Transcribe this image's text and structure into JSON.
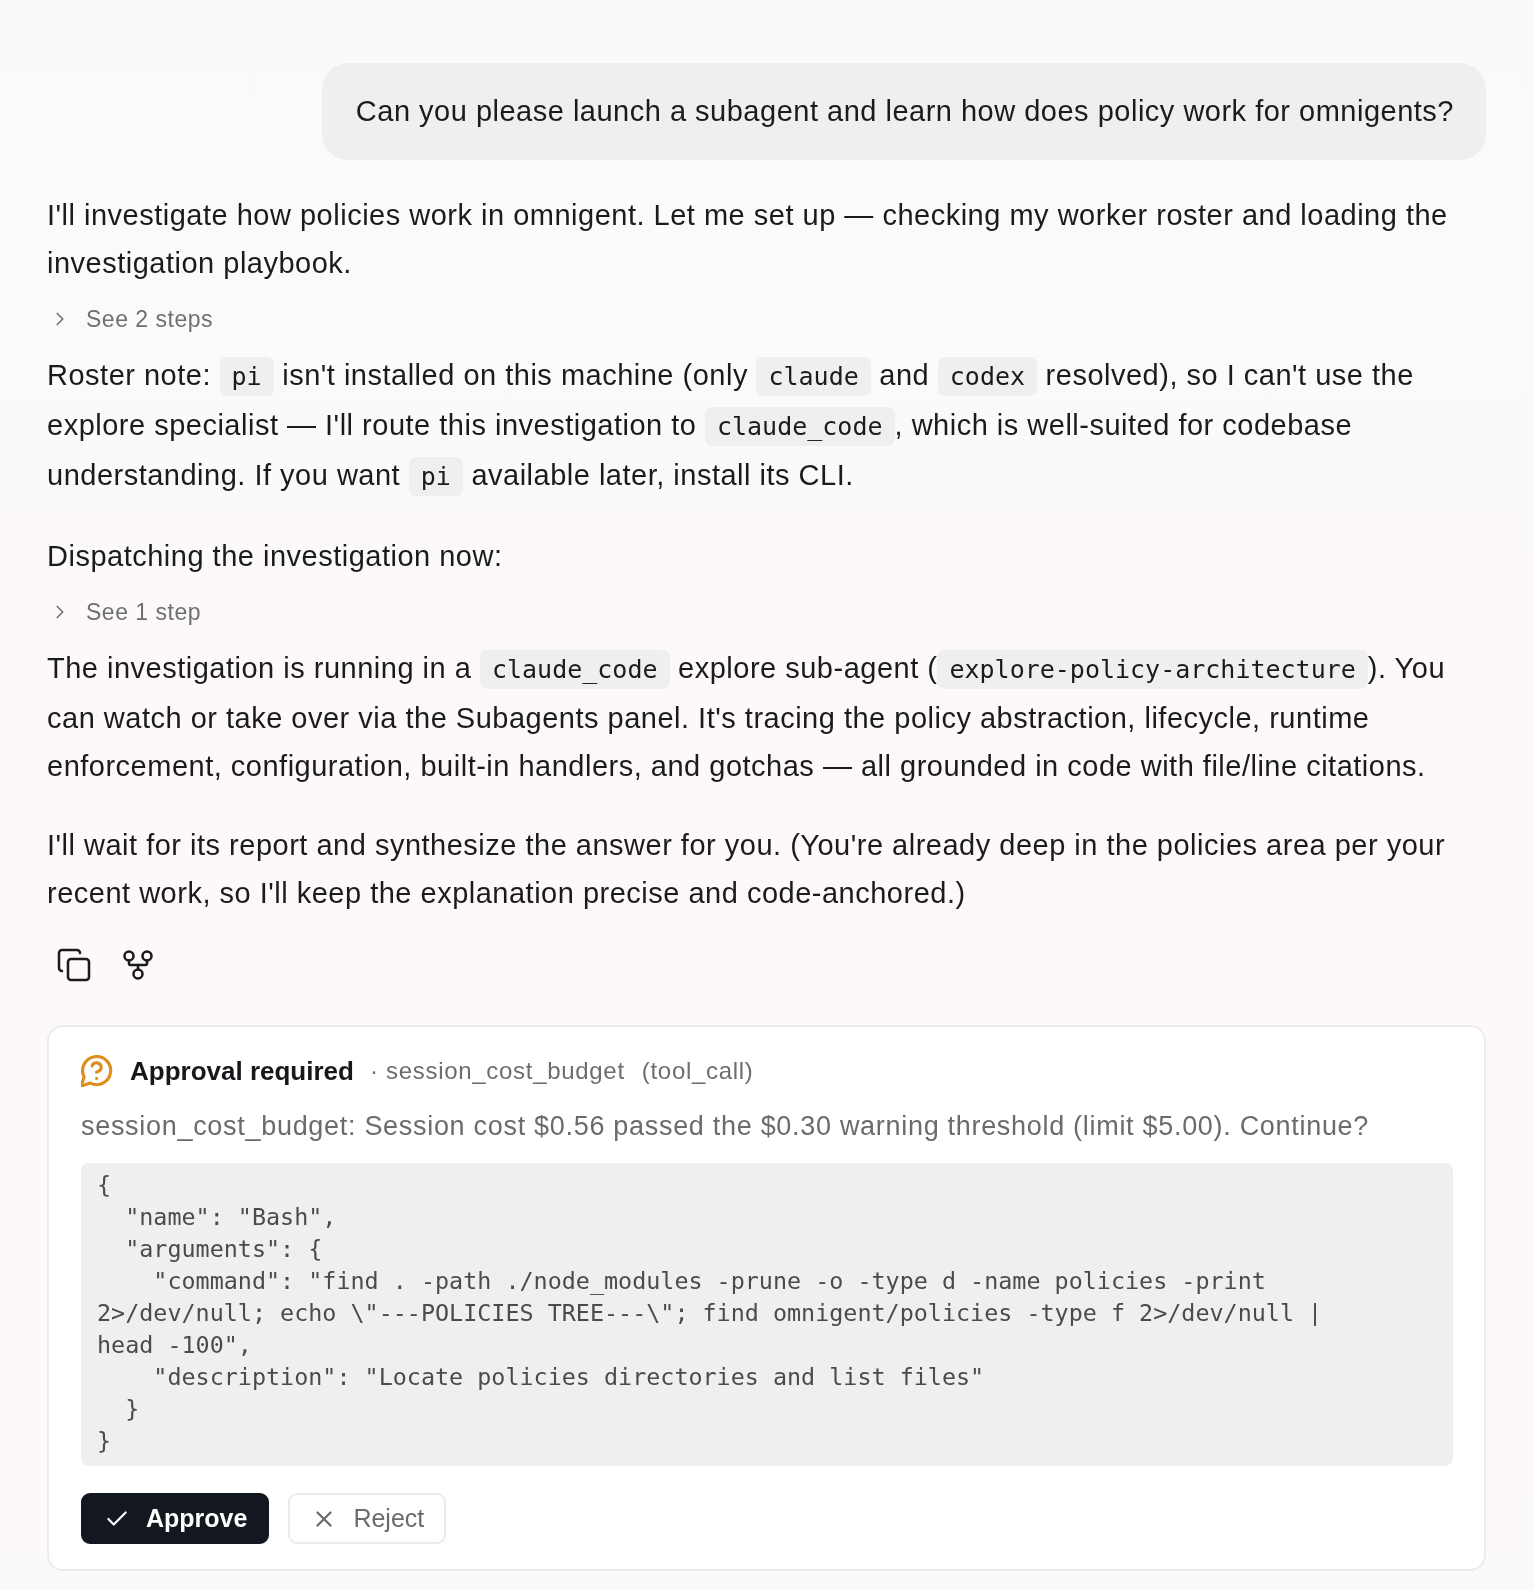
{
  "user_message": {
    "text": "Can you please launch a subagent and learn how does policy work for omnigents?"
  },
  "assistant_message": {
    "blocks": [
      {
        "kind": "paragraph",
        "segments": [
          {
            "kind": "text",
            "text": "I'll investigate how policies work in omnigent. Let me set up — checking my worker roster and loading the investigation playbook."
          }
        ]
      },
      {
        "kind": "steps",
        "label": "See 2 steps",
        "expanded": false
      },
      {
        "kind": "paragraph",
        "segments": [
          {
            "kind": "text",
            "text": "Roster note: "
          },
          {
            "kind": "code",
            "text": "pi"
          },
          {
            "kind": "text",
            "text": " isn't installed on this machine (only "
          },
          {
            "kind": "code",
            "text": "claude"
          },
          {
            "kind": "text",
            "text": " and "
          },
          {
            "kind": "code",
            "text": "codex"
          },
          {
            "kind": "text",
            "text": " resolved), so I can't use the explore specialist — I'll route this investigation to "
          },
          {
            "kind": "code",
            "text": "claude_code"
          },
          {
            "kind": "text",
            "text": ", which is well-suited for codebase understanding. If you want "
          },
          {
            "kind": "code",
            "text": "pi"
          },
          {
            "kind": "text",
            "text": " available later, install its CLI."
          }
        ]
      },
      {
        "kind": "paragraph",
        "segments": [
          {
            "kind": "text",
            "text": "Dispatching the investigation now:"
          }
        ]
      },
      {
        "kind": "steps",
        "label": "See 1 step",
        "expanded": false
      },
      {
        "kind": "paragraph",
        "segments": [
          {
            "kind": "text",
            "text": "The investigation is running in a "
          },
          {
            "kind": "code",
            "text": "claude_code"
          },
          {
            "kind": "text",
            "text": " explore sub-agent ("
          },
          {
            "kind": "code",
            "text": "explore-policy-architecture"
          },
          {
            "kind": "text",
            "text": "). You can watch or take over via the Subagents panel. It's tracing the policy abstraction, lifecycle, runtime enforcement, configuration, built-in handlers, and gotchas — all grounded in code with file/line citations."
          }
        ]
      },
      {
        "kind": "paragraph",
        "segments": [
          {
            "kind": "text",
            "text": "I'll wait for its report and synthesize the answer for you. (You're already deep in the policies area per your recent work, so I'll keep the explanation precise and code-anchored.)"
          }
        ]
      }
    ],
    "actions": [
      {
        "kind": "copy"
      },
      {
        "kind": "fork"
      }
    ]
  },
  "approval": {
    "title": "Approval required",
    "policy": "· session_cost_budget",
    "call_type": "(tool_call)",
    "message": "session_cost_budget: Session cost $0.56 passed the $0.30 warning threshold (limit $5.00). Continue?",
    "code_lines": [
      "{",
      "  \"name\": \"Bash\",",
      "  \"arguments\": {",
      "    \"command\": \"find . -path ./node_modules -prune -o -type d -name policies -print",
      "2>/dev/null; echo \\\"---POLICIES TREE---\\\"; find omnigent/policies -type f 2>/dev/null |",
      "head -100\",",
      "    \"description\": \"Locate policies directories and list files\"",
      "  }",
      "}"
    ],
    "buttons": [
      {
        "label": "Approve",
        "kind": "approve"
      },
      {
        "label": "Reject",
        "kind": "reject"
      }
    ]
  }
}
